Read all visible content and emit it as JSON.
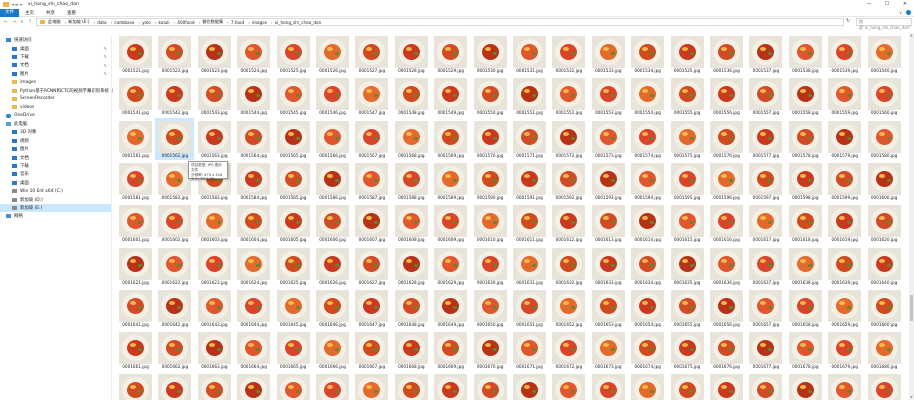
{
  "window": {
    "title": "xi_hong_shi_chao_dan",
    "qat": "▾ ⇄ ▾",
    "minimize": "—",
    "maximize": "☐",
    "close": "✕"
  },
  "ribbon": {
    "file": "文件",
    "tabs": [
      "主页",
      "共享",
      "查看"
    ],
    "expand": "∨"
  },
  "nav": {
    "back": "←",
    "forward": "→",
    "recent": "∨",
    "up": "↑"
  },
  "address": {
    "crumbs": [
      "此电脑",
      "新加坡 (E:)",
      "data",
      "codebase",
      "yolo",
      "kaluli",
      "400food",
      "餐饮数据集",
      "7.food",
      "images",
      "xi_hong_shi_chao_dan"
    ],
    "refresh": "↻",
    "search_placeholder": "搜索\"xi_hong_shi_chao_dan\""
  },
  "sidebar": {
    "items": [
      {
        "label": "快速访问",
        "icon": "star",
        "indent": 6,
        "pin": false,
        "selected": false
      },
      {
        "label": "桌面",
        "icon": "blue",
        "indent": 12,
        "pin": true,
        "selected": false
      },
      {
        "label": "下载",
        "icon": "blue",
        "indent": 12,
        "pin": true,
        "selected": false
      },
      {
        "label": "文档",
        "icon": "blue",
        "indent": 12,
        "pin": true,
        "selected": false
      },
      {
        "label": "图片",
        "icon": "blue",
        "indent": 12,
        "pin": true,
        "selected": false
      },
      {
        "label": "images",
        "icon": "folder",
        "indent": 12,
        "pin": false,
        "selected": false
      },
      {
        "label": "Python基于RCNN和CTC的视频字幕识别系统（",
        "icon": "folder",
        "indent": 12,
        "pin": false,
        "selected": false
      },
      {
        "label": "ScreenRecorder",
        "icon": "folder",
        "indent": 12,
        "pin": false,
        "selected": false
      },
      {
        "label": "videos",
        "icon": "folder",
        "indent": 12,
        "pin": false,
        "selected": false
      },
      {
        "label": "OneDrive",
        "icon": "cloud",
        "indent": 6,
        "pin": false,
        "selected": false
      },
      {
        "label": "此电脑",
        "icon": "pc",
        "indent": 6,
        "pin": false,
        "selected": false
      },
      {
        "label": "3D 对象",
        "icon": "blue",
        "indent": 12,
        "pin": false,
        "selected": false
      },
      {
        "label": "视频",
        "icon": "blue",
        "indent": 12,
        "pin": false,
        "selected": false
      },
      {
        "label": "图片",
        "icon": "blue",
        "indent": 12,
        "pin": false,
        "selected": false
      },
      {
        "label": "文档",
        "icon": "blue",
        "indent": 12,
        "pin": false,
        "selected": false
      },
      {
        "label": "下载",
        "icon": "blue",
        "indent": 12,
        "pin": false,
        "selected": false
      },
      {
        "label": "音乐",
        "icon": "blue",
        "indent": 12,
        "pin": false,
        "selected": false
      },
      {
        "label": "桌面",
        "icon": "blue",
        "indent": 12,
        "pin": false,
        "selected": false
      },
      {
        "label": "Win 10 Ent x64 (C:)",
        "icon": "drive",
        "indent": 12,
        "pin": false,
        "selected": false
      },
      {
        "label": "新加坡 (D:)",
        "icon": "drive",
        "indent": 12,
        "pin": false,
        "selected": false
      },
      {
        "label": "新加坡 (E:)",
        "icon": "drive",
        "indent": 12,
        "pin": false,
        "selected": true
      },
      {
        "label": "网络",
        "icon": "net",
        "indent": 6,
        "pin": false,
        "selected": false
      }
    ]
  },
  "files": {
    "start": 1521,
    "end": 1700,
    "visible_rows": 9,
    "suffix": ".jpg",
    "selected": "0001562.jpg"
  },
  "tooltip": {
    "line1": "项目类型: JPG 图片文件",
    "line2": "分辨率: 474 x 316",
    "line3": "大小: 52.7 KB"
  },
  "scroll": {
    "up": "▲",
    "down": "▼",
    "position": 0.72
  },
  "colors": {
    "accent": "#1979ca",
    "selection": "#cce8ff",
    "folder": "#e8b84a"
  }
}
